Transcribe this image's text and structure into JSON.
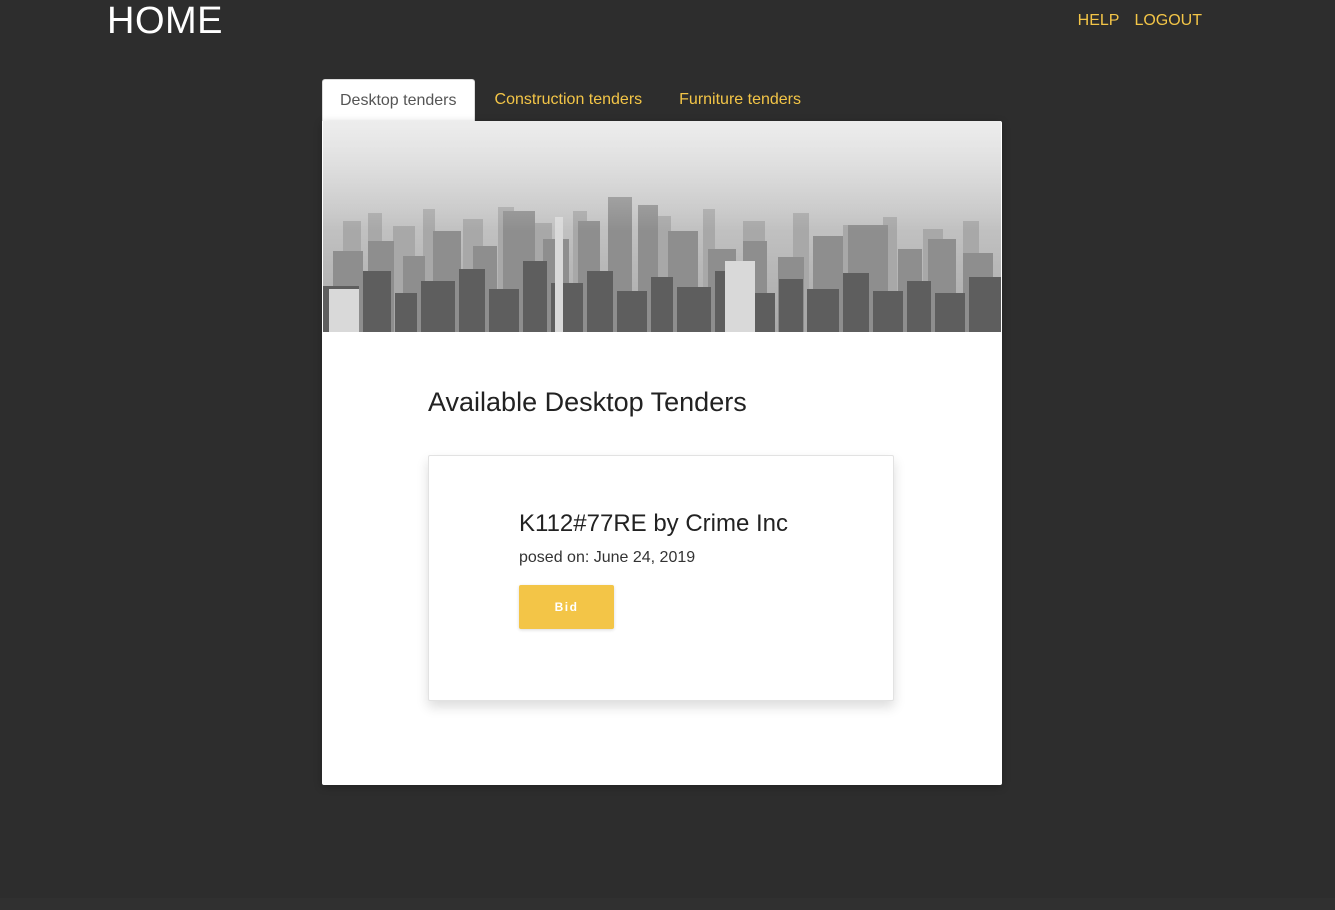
{
  "header": {
    "brand": "HOME",
    "nav": [
      {
        "label": "HELP"
      },
      {
        "label": "LOGOUT"
      }
    ]
  },
  "tabs": [
    {
      "label": "Desktop tenders",
      "active": true
    },
    {
      "label": "Construction tenders",
      "active": false
    },
    {
      "label": "Furniture tenders",
      "active": false
    }
  ],
  "main": {
    "section_title": "Available Desktop Tenders",
    "tenders": [
      {
        "title": "K112#77RE by Crime Inc",
        "date": "posed on: June 24, 2019",
        "action_label": "Bid"
      }
    ]
  },
  "colors": {
    "background": "#2d2d2d",
    "accent": "#f3c547",
    "panel": "#ffffff"
  }
}
